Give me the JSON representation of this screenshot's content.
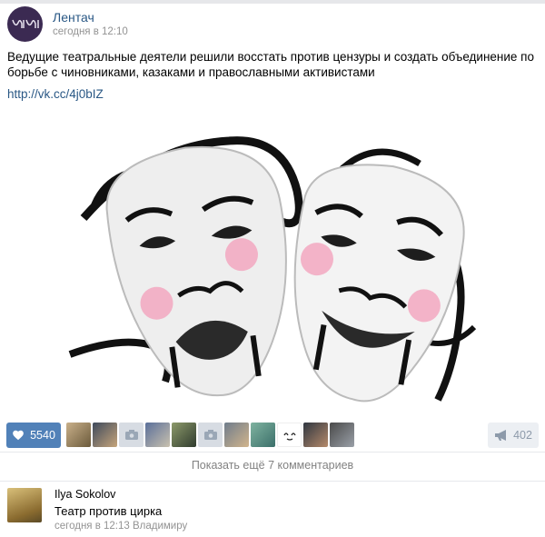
{
  "post": {
    "author": "Лентач",
    "time": "сегодня в 12:10",
    "text": "Ведущие театральные деятели решили восстать против цензуры и создать объединение по борьбе с чиновниками, казаками и православными активистами",
    "link": "http://vk.cc/4j0bIZ",
    "avatar_icon": "lentach-logo-icon",
    "image_icon": "theatre-masks-icon"
  },
  "actions": {
    "likes": "5540",
    "reposts": "402",
    "like_icon": "heart-icon",
    "repost_icon": "megaphone-icon"
  },
  "comments": {
    "show_more": "Показать ещё 7 комментариев"
  },
  "comment": {
    "author": "Ilya Sokolov",
    "text": "Театр против цирка",
    "meta": "сегодня в 12:13 Владимиру"
  },
  "colors": {
    "accent": "#5181b8",
    "link": "#2a5885",
    "muted": "#939393"
  }
}
